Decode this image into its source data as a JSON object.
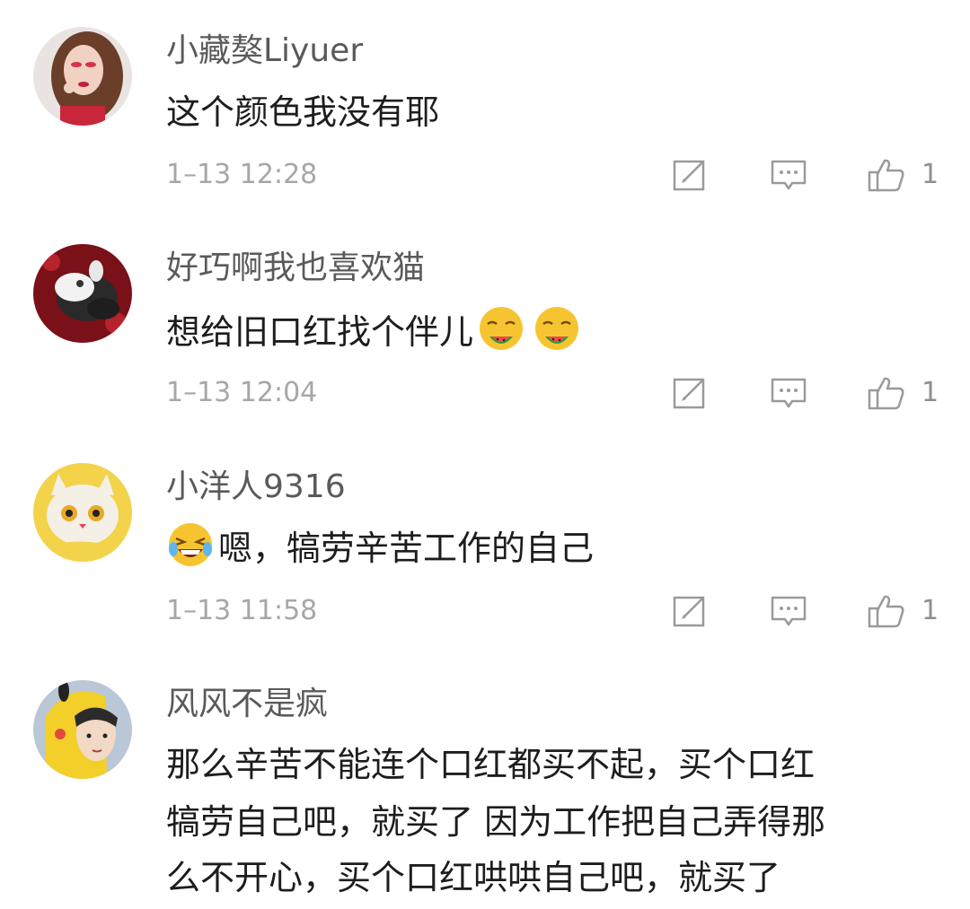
{
  "comments": [
    {
      "username": "小藏獒Liyuer",
      "text": "这个颜色我没有耶",
      "time": "1–13 12:28",
      "likes": "1"
    },
    {
      "username": "好巧啊我也喜欢猫",
      "text": "想给旧口红找个伴儿",
      "emojis": [
        "watermelon-eating-emoji",
        "watermelon-eating-emoji"
      ],
      "time": "1–13 12:04",
      "likes": "1"
    },
    {
      "username": "小洋人9316",
      "emoji": "laughing-tears-emoji",
      "text": "嗯，犒劳辛苦工作的自己",
      "time": "1–13 11:58",
      "likes": "1"
    },
    {
      "username": "风风不是疯",
      "lines": [
        "那么辛苦不能连个口红都买不起，买个口红",
        "犒劳自己吧，就买了 因为工作把自己弄得那",
        "么不开心，买个口红哄哄自己吧，就买了"
      ]
    }
  ],
  "icons": {
    "edit": "repost-edit-icon",
    "comment": "comment-icon",
    "like": "thumbs-up-icon"
  },
  "colors": {
    "username": "#5a5a5a",
    "text": "#1d1d1d",
    "meta": "#a7a7a7",
    "icon": "#9a9a9a"
  }
}
